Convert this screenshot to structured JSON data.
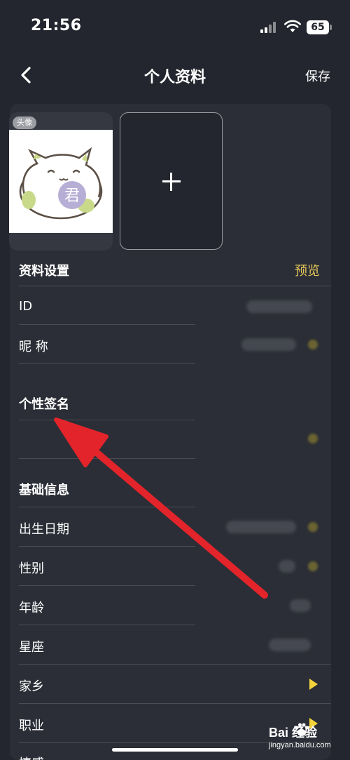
{
  "status_bar": {
    "time": "21:56",
    "battery": "65"
  },
  "nav": {
    "title": "个人资料",
    "save_label": "保存"
  },
  "avatar": {
    "badge": "头像",
    "seal_char": "君"
  },
  "profile_settings": {
    "title": "资料设置",
    "preview_label": "预览"
  },
  "rows_settings": [
    {
      "label": "ID"
    },
    {
      "label": "昵 称"
    }
  ],
  "signature": {
    "title": "个性签名"
  },
  "basic_info": {
    "title": "基础信息"
  },
  "rows_basic": [
    {
      "label": "出生日期"
    },
    {
      "label": "性别"
    },
    {
      "label": "年龄"
    },
    {
      "label": "星座"
    },
    {
      "label": "家乡"
    },
    {
      "label": "职业"
    },
    {
      "label": "情感"
    }
  ],
  "watermark": {
    "brand": "Bai 经验",
    "url": "jingyan.baidu.com"
  },
  "colors": {
    "background": "#23262e",
    "panel": "#2b2e36",
    "accent": "#e6c75a",
    "arrow": "#e3242b",
    "chevron": "#f2d33b"
  }
}
